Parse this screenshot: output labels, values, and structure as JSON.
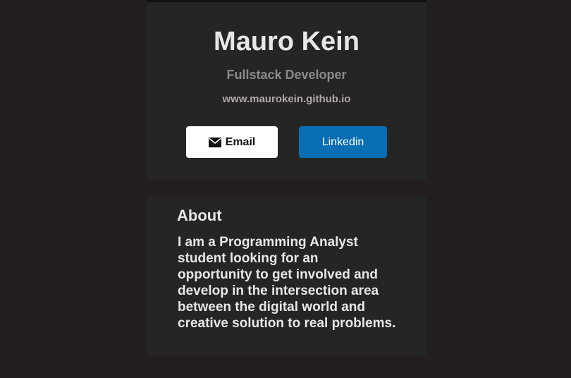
{
  "profile": {
    "name": "Mauro Kein",
    "role": "Fullstack Developer",
    "website": "www.maurokein.github.io"
  },
  "buttons": {
    "email_label": "Email",
    "email_icon": "envelope-icon",
    "linkedin_label": "Linkedin"
  },
  "about": {
    "title": "About",
    "body": "I am a Programming Analyst student looking for an opportunity to get involved and develop in the intersection area between the digital world and creative solution to real problems."
  },
  "colors": {
    "page_background": "#231f20",
    "card_background": "#252523",
    "linkedin_blue": "#0a6eb4",
    "email_button": "#ffffff"
  }
}
